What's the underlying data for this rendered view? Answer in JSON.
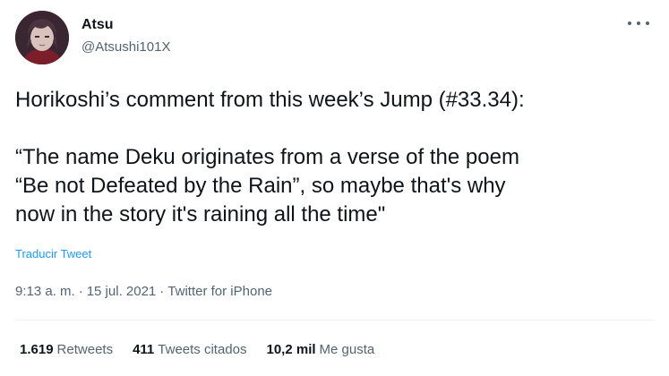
{
  "user": {
    "display_name": "Atsu",
    "handle": "@Atsushi101X",
    "avatar_icon": "profile-photo"
  },
  "tweet": {
    "lines": [
      "Horikoshi’s comment from this week’s Jump (#33.34):",
      "“The name Deku originates from a verse of the poem",
      "“Be not Defeated by the Rain”, so maybe that's why",
      "now in the story it's raining all the time\""
    ],
    "translate_label": "Traducir Tweet"
  },
  "meta": {
    "time": "9:13 a. m.",
    "separator": "·",
    "date": "15 jul. 2021",
    "source": "Twitter for iPhone"
  },
  "stats": {
    "retweets_count": "1.619",
    "retweets_label": "Retweets",
    "quotes_count": "411",
    "quotes_label": "Tweets citados",
    "likes_count": "10,2 mil",
    "likes_label": "Me gusta"
  },
  "colors": {
    "text": "#0f1419",
    "secondary": "#536471",
    "link": "#1d9bf0",
    "divider": "#eff3f4"
  }
}
